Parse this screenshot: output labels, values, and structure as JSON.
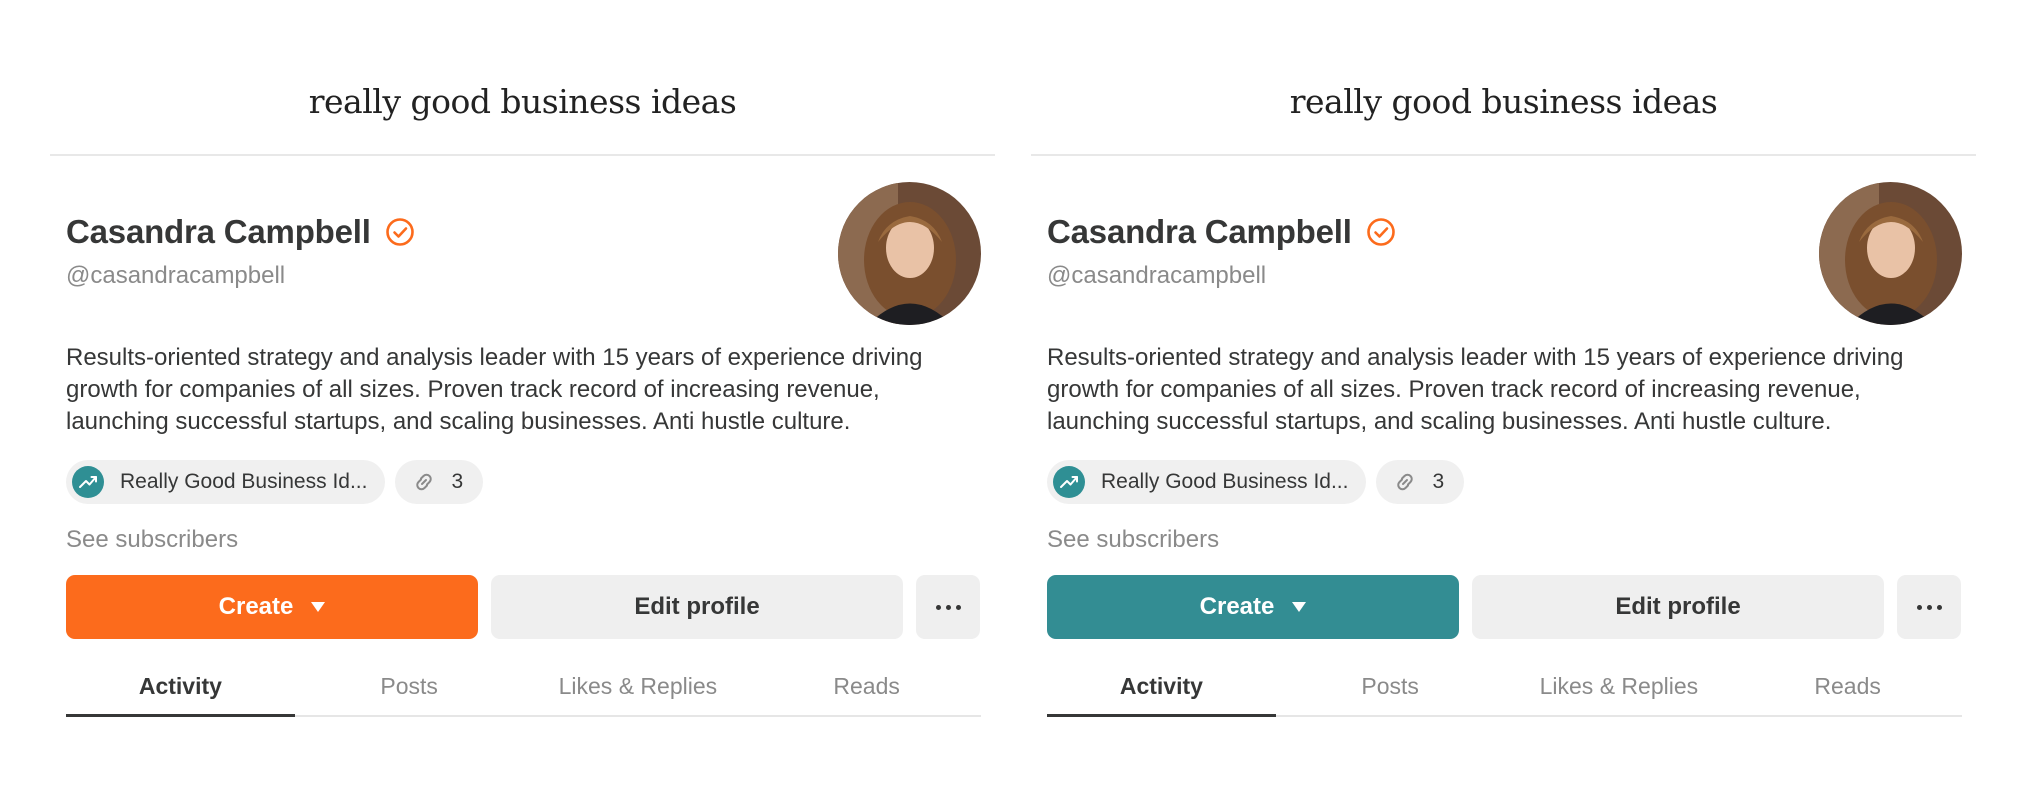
{
  "panels": [
    {
      "brand": "really good business ideas",
      "profile": {
        "name": "Casandra Campbell",
        "handle": "@casandracampbell",
        "bio": "Results-oriented strategy and analysis leader with 15 years of experience driving growth for companies of all sizes. Proven track record of increasing revenue, launching successful startups, and scaling businesses. Anti hustle culture."
      },
      "chips": {
        "publication": "Really Good Business Id...",
        "links_count": "3"
      },
      "see_subscribers": "See subscribers",
      "actions": {
        "create": "Create",
        "edit": "Edit profile"
      },
      "tabs": [
        "Activity",
        "Posts",
        "Likes & Replies",
        "Reads"
      ],
      "accent": "#fc6b1c"
    },
    {
      "brand": "really good business ideas",
      "profile": {
        "name": "Casandra Campbell",
        "handle": "@casandracampbell",
        "bio": "Results-oriented strategy and analysis leader with 15 years of experience driving growth for companies of all sizes. Proven track record of increasing revenue, launching successful startups, and scaling businesses. Anti hustle culture."
      },
      "chips": {
        "publication": "Really Good Business Id...",
        "links_count": "3"
      },
      "see_subscribers": "See subscribers",
      "actions": {
        "create": "Create",
        "edit": "Edit profile"
      },
      "tabs": [
        "Activity",
        "Posts",
        "Likes & Replies",
        "Reads"
      ],
      "accent": "#338d93"
    }
  ],
  "colors": {
    "verified": "#fc6b1c",
    "publication_icon": "#2f8f94"
  },
  "icons": {
    "verified": "check-circle-icon",
    "publication": "trending-up-icon",
    "links": "link-icon",
    "more": "ellipsis-icon",
    "create_caret": "caret-down-icon"
  }
}
